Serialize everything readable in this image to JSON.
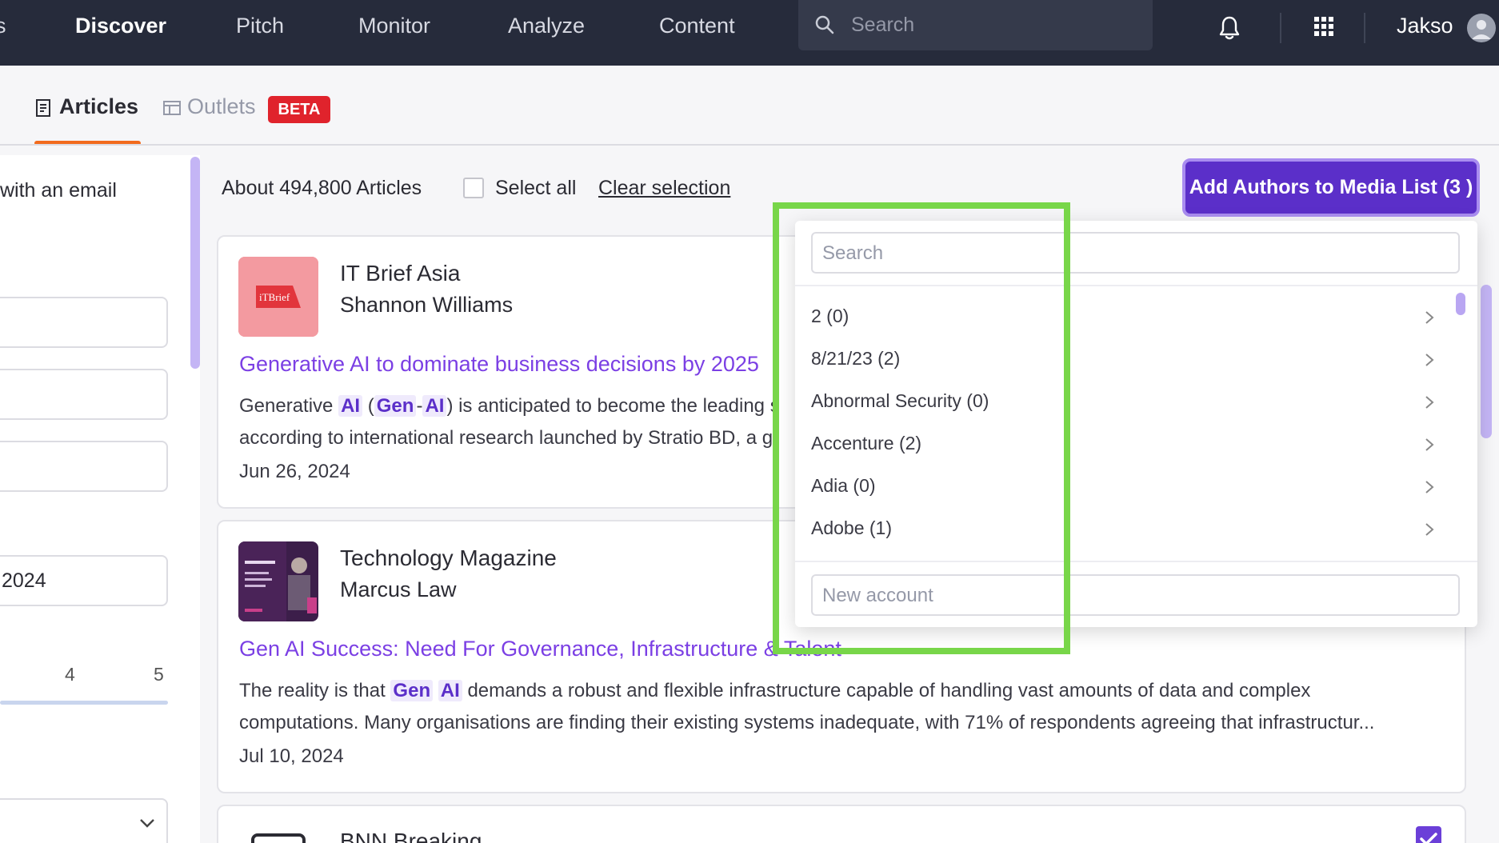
{
  "topnav": {
    "edge_glyph": "s",
    "items": [
      {
        "label": "Discover",
        "active": true
      },
      {
        "label": "Pitch",
        "active": false
      },
      {
        "label": "Monitor",
        "active": false
      },
      {
        "label": "Analyze",
        "active": false
      },
      {
        "label": "Content",
        "active": false
      }
    ],
    "search_placeholder": "Search",
    "user_name": "Jakso",
    "icons": [
      "search-icon",
      "bell-icon",
      "apps-grid-icon",
      "user-avatar-icon"
    ]
  },
  "tabs": {
    "articles": "Articles",
    "outlets": "Outlets",
    "beta_badge": "BETA",
    "active": "Articles"
  },
  "sidebar": {
    "email_text": "with an email",
    "date_value": "2024",
    "slider_ticks": [
      "4",
      "5"
    ]
  },
  "results": {
    "count": "About 494,800 Articles",
    "select_all": "Select all",
    "clear_selection": "Clear selection",
    "add_button": "Add Authors to Media List (3 )"
  },
  "articles": [
    {
      "outlet": "IT Brief Asia",
      "author": "Shannon Williams",
      "title": "Generative AI to dominate business decisions by 2025",
      "snippet_line1_a": "Generative ",
      "snippet_line1_hl1": "AI",
      "snippet_line1_b": " (",
      "snippet_line1_hl2": "Gen",
      "snippet_line1_c": "-",
      "snippet_line1_hl3": "AI",
      "snippet_line1_d": ") is anticipated to become the leading s",
      "snippet_line2": "according to international research launched by Stratio BD, a g",
      "date": "Jun 26, 2024",
      "thumb_text": "iTBrief"
    },
    {
      "outlet": "Technology Magazine",
      "author": "Marcus Law",
      "title": "Gen AI Success: Need For Governance, Infrastructure & Talent",
      "snippet_line1_a": "The reality is that ",
      "snippet_line1_hl1": "Gen",
      "snippet_line1_hl2": "AI",
      "snippet_line1_b": " demands a robust and flexible infrastructure capable of handling vast amounts of data and complex",
      "snippet_line2": "computations. Many organisations are finding their existing systems inadequate, with 71% of respondents agreeing that infrastructur...",
      "date": "Jul 10, 2024"
    },
    {
      "outlet": "BNN Breaking",
      "selected": true
    }
  ],
  "media_list_dropdown": {
    "search_placeholder": "Search",
    "items": [
      {
        "label": "2 (0)"
      },
      {
        "label": "8/21/23 (2)"
      },
      {
        "label": "Abnormal Security (0)"
      },
      {
        "label": "Accenture (2)"
      },
      {
        "label": "Adia (0)"
      },
      {
        "label": "Adobe (1)"
      }
    ],
    "new_account_placeholder": "New account"
  },
  "colors": {
    "nav_bg": "#262b3b",
    "accent_purple": "#5b2fc9",
    "headline_purple": "#7b3fe4",
    "tab_underline": "#f26b1d",
    "beta_red": "#e0232c",
    "highlight_green": "#78d649"
  }
}
